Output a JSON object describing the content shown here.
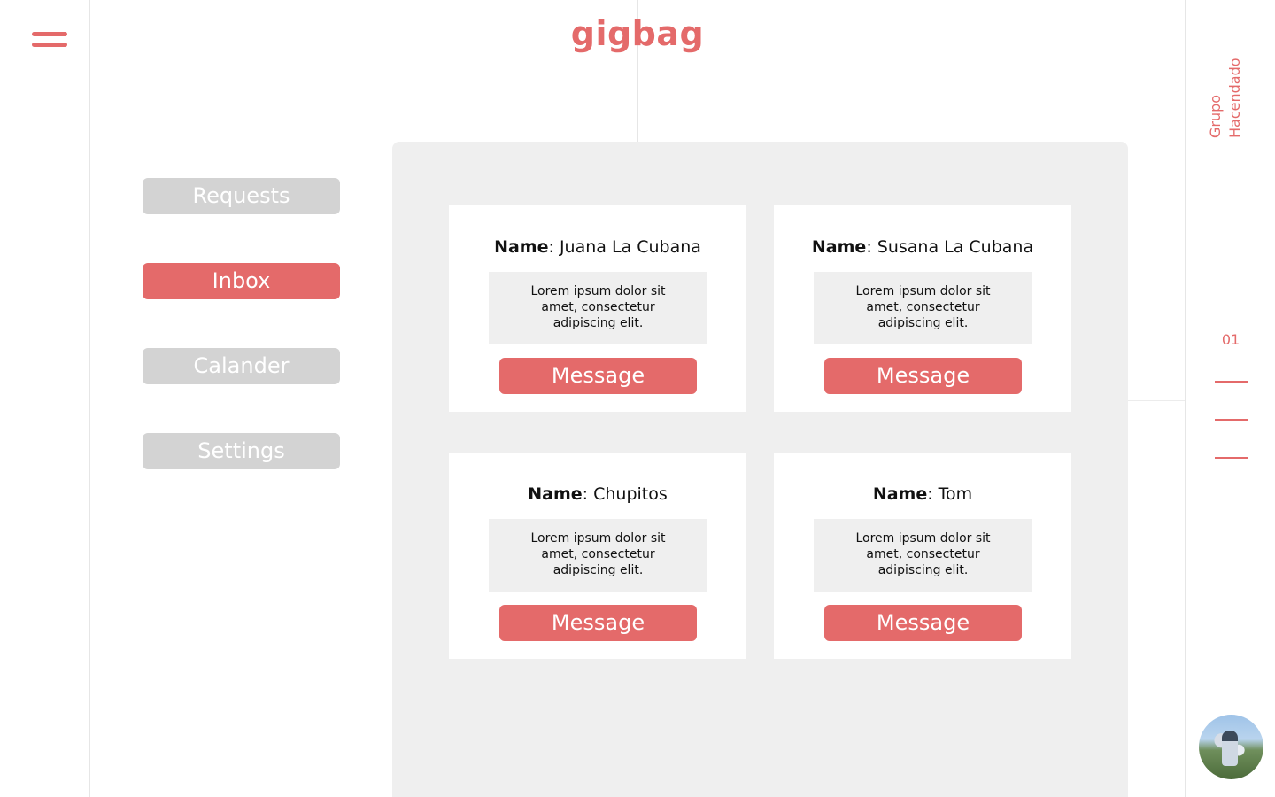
{
  "header": {
    "logo_text": "gigbag",
    "menu_icon": "hamburger-icon"
  },
  "brand": {
    "vertical_text": "Grupo Hacendado"
  },
  "pager": {
    "current": "01"
  },
  "sidebar": {
    "items": [
      {
        "label": "Requests",
        "active": false
      },
      {
        "label": "Inbox",
        "active": true
      },
      {
        "label": "Calander",
        "active": false
      },
      {
        "label": "Settings",
        "active": false
      }
    ]
  },
  "inbox": {
    "cards": [
      {
        "name_label": "Name",
        "name_value": ": Juana La Cubana",
        "description": "Lorem ipsum dolor sit amet, consectetur adipiscing elit.",
        "button_label": "Message"
      },
      {
        "name_label": "Name",
        "name_value": ": Susana La Cubana",
        "description": "Lorem ipsum dolor sit amet, consectetur adipiscing elit.",
        "button_label": "Message"
      },
      {
        "name_label": "Name",
        "name_value": ": Chupitos",
        "description": "Lorem ipsum dolor sit amet, consectetur adipiscing elit.",
        "button_label": "Message"
      },
      {
        "name_label": "Name",
        "name_value": ": Tom",
        "description": "Lorem ipsum dolor sit amet, consectetur adipiscing elit.",
        "button_label": "Message"
      }
    ]
  },
  "colors": {
    "accent": "#e46a6a",
    "nav_inactive": "#d3d3d3",
    "panel_bg": "#efefef"
  },
  "avatar": {
    "icon": "user-avatar"
  }
}
